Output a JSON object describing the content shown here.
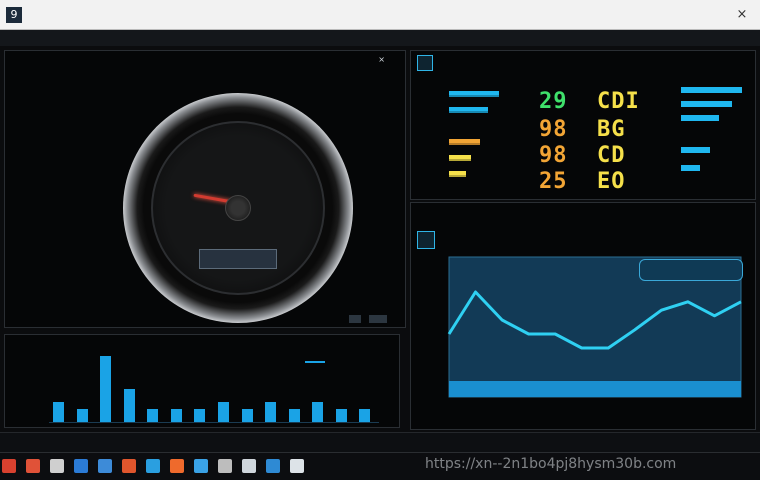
{
  "window": {
    "icon_glyph": "9",
    "title": "",
    "close_glyph": "×"
  },
  "menubar": {
    "items": [
      "",
      "",
      ""
    ]
  },
  "left_panel": {
    "header_glyphs": [
      "",
      "",
      "×"
    ],
    "list_items": [
      "",
      "",
      "",
      "",
      "",
      "",
      "",
      "",
      "",
      "",
      "",
      "",
      "",
      "",
      "",
      "",
      "",
      "",
      "",
      "",
      "",
      "",
      "",
      ""
    ],
    "footer_text": ""
  },
  "speedometer": {
    "scale_labels": [
      "",
      "",
      "",
      "",
      "",
      "",
      "",
      ""
    ],
    "center_label": "",
    "lcd_value": "",
    "readout_value": "",
    "needle_level": 0.25
  },
  "bar_chart": {
    "header_label": "",
    "header_value": "",
    "values": [
      3,
      2,
      10,
      5,
      2,
      2,
      2,
      3,
      2,
      3,
      2,
      3,
      2,
      2
    ]
  },
  "digits_panel": {
    "title": "",
    "left_top_values": [
      "29",
      "98",
      "98",
      "25"
    ],
    "right_values": [
      "CDI",
      "BG",
      "CD",
      "EO"
    ],
    "left_bar_levels": [
      0.9,
      0.7,
      0.55,
      0.4,
      0.3
    ],
    "right_bar_levels": [
      0.95,
      0.8,
      0.6,
      0.45,
      0.3
    ],
    "colors": {
      "green": "#3fe06b",
      "orange": "#f2a535",
      "yellow": "#f5e04a",
      "cyan": "#1fb7ef"
    }
  },
  "line_chart_panel": {
    "header_label": "",
    "title": "",
    "badge_left": "",
    "badge_right": ""
  },
  "chart_data": {
    "type": "line",
    "x": [
      0,
      1,
      2,
      3,
      4,
      5,
      6,
      7,
      8,
      9,
      10,
      11
    ],
    "series": [
      {
        "values": [
          0.45,
          0.75,
          0.55,
          0.45,
          0.45,
          0.35,
          0.35,
          0.48,
          0.62,
          0.68,
          0.58,
          0.68
        ]
      }
    ],
    "title": "",
    "xlabel": "",
    "ylabel": "",
    "ylim": [
      0,
      1
    ],
    "x_tick_labels": [
      "",
      "",
      "",
      "",
      "",
      ""
    ],
    "y_tick_labels": [
      "",
      "",
      "",
      "",
      ""
    ],
    "grid": false,
    "line_color": "#2fd0f2"
  },
  "taskbar": {
    "icons": [
      "red-app-icon",
      "red-app-icon",
      "document-app-icon",
      "blue-app-icon",
      "browser-icon",
      "window-icon",
      "file-app-icon",
      "orange-app-icon",
      "image-app-icon",
      "media-app-icon",
      "image-app-icon",
      "mail-app-icon",
      "mail-app-icon"
    ],
    "icon_colors": [
      "#d8412f",
      "#e05238",
      "#cfcfcf",
      "#2b7bd6",
      "#3d8bd8",
      "#e0562d",
      "#2a9fe0",
      "#ef6a2c",
      "#3aa2e6",
      "#bdbdbd",
      "#cfd6dc",
      "#2e8ad4",
      "#dde3e8"
    ],
    "watermark": "https://xn--2n1bo4pj8hysm30b.com"
  }
}
